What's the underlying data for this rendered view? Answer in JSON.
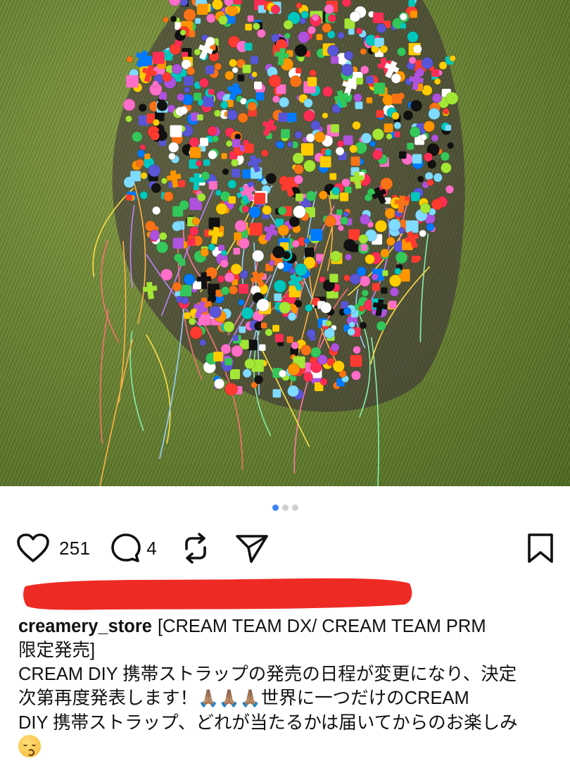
{
  "post": {
    "image_alt": "Colorful beaded phone straps piled on grass",
    "carousel": {
      "count": 3,
      "active_index": 0
    },
    "actions": {
      "like_count": "251",
      "comment_count": "4"
    },
    "caption": {
      "username": "creamery_store",
      "text_lines": [
        "[CREAM TEAM DX/ CREAM TEAM PRM",
        "限定発売]",
        "CREAM DIY 携帯ストラップの発売の日程が変更になり、決定",
        "次第再度発表します！",
        "世界に一つだけのCREAM",
        "DIY 携帯ストラップ、どれが当たるかは届いてからのお楽しみ"
      ],
      "emoji": {
        "pray": "🙏🏽🙏🏽🙏🏽",
        "kiss": "kissing-face"
      }
    },
    "colors": {
      "accent": "#3b82f6",
      "redaction": "#ee2a24"
    }
  }
}
